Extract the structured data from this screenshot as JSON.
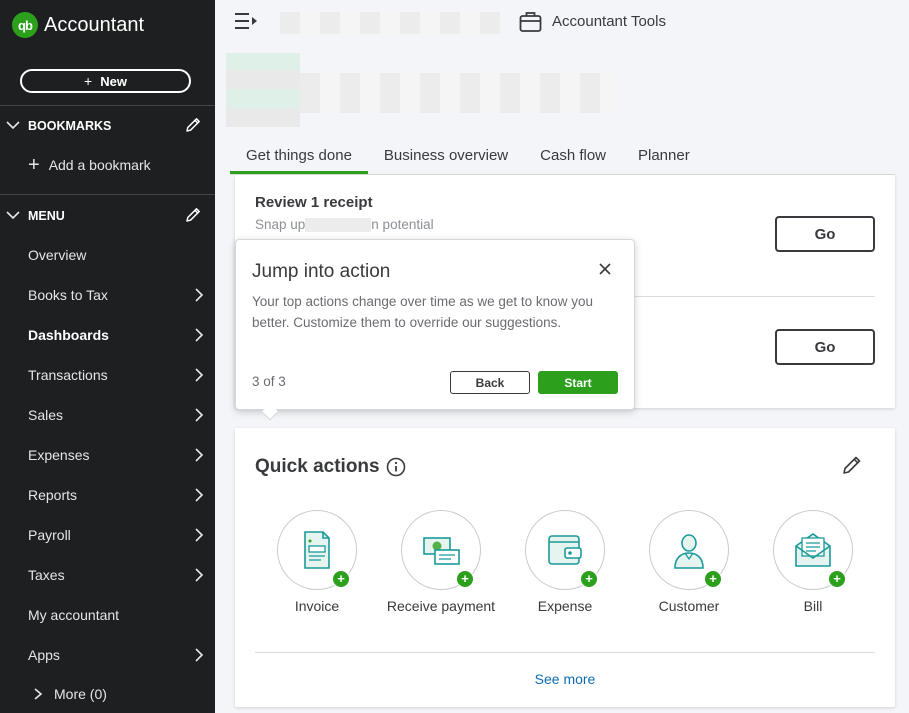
{
  "app": {
    "logo_mark": "qb",
    "name": "Accountant"
  },
  "sidebar": {
    "new_label": "New",
    "bookmarks_label": "BOOKMARKS",
    "add_bookmark_label": "Add a bookmark",
    "menu_label": "MENU",
    "items": [
      {
        "label": "Overview",
        "arrow": false,
        "active": false
      },
      {
        "label": "Books to Tax",
        "arrow": true,
        "active": false
      },
      {
        "label": "Dashboards",
        "arrow": true,
        "active": true
      },
      {
        "label": "Transactions",
        "arrow": true,
        "active": false
      },
      {
        "label": "Sales",
        "arrow": true,
        "active": false
      },
      {
        "label": "Expenses",
        "arrow": true,
        "active": false
      },
      {
        "label": "Reports",
        "arrow": true,
        "active": false
      },
      {
        "label": "Payroll",
        "arrow": true,
        "active": false
      },
      {
        "label": "Taxes",
        "arrow": true,
        "active": false
      },
      {
        "label": "My accountant",
        "arrow": false,
        "active": false
      },
      {
        "label": "Apps",
        "arrow": true,
        "active": false
      }
    ],
    "more_label": "More (0)"
  },
  "header": {
    "accountant_tools_label": "Accountant Tools"
  },
  "tabs": [
    {
      "label": "Get things done",
      "active": true
    },
    {
      "label": "Business overview",
      "active": false
    },
    {
      "label": "Cash flow",
      "active": false
    },
    {
      "label": "Planner",
      "active": false
    }
  ],
  "tasks": {
    "first_title": "Review 1 receipt",
    "first_subtitle_start": "Snap up",
    "first_subtitle_end": "n potential",
    "go_label": "Go"
  },
  "popover": {
    "title": "Jump into action",
    "body": "Your top actions change over time as we get to know you better. Customize them to override our suggestions.",
    "step": "3 of 3",
    "back_label": "Back",
    "start_label": "Start"
  },
  "quick_actions": {
    "title": "Quick actions",
    "items": [
      {
        "label": "Invoice",
        "icon": "invoice-icon"
      },
      {
        "label": "Receive payment",
        "icon": "receive-payment-icon"
      },
      {
        "label": "Expense",
        "icon": "expense-icon"
      },
      {
        "label": "Customer",
        "icon": "customer-icon"
      },
      {
        "label": "Bill",
        "icon": "bill-icon"
      }
    ],
    "see_more_label": "See more"
  },
  "colors": {
    "brand_green": "#2ca01c",
    "sidebar_bg": "#1e1f20",
    "link_blue": "#0d6bb4",
    "icon_teal": "#1a9a9a"
  }
}
